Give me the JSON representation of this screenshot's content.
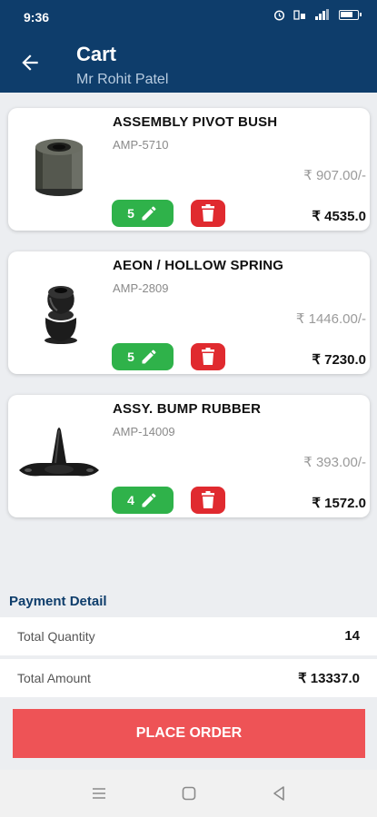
{
  "status_bar": {
    "time": "9:36",
    "icons": [
      "alarm-icon",
      "volte-icon",
      "signal-icon",
      "battery-icon"
    ]
  },
  "header": {
    "title": "Cart",
    "subtitle": "Mr Rohit Patel",
    "back_icon": "arrow-left-icon"
  },
  "cart_items": [
    {
      "name": "ASSEMBLY PIVOT BUSH",
      "code": "AMP-5710",
      "unit_price": "₹ 907.00/-",
      "quantity": "5",
      "total": "₹ 4535.0",
      "image": "pivot-bush-image"
    },
    {
      "name": "AEON / HOLLOW SPRING",
      "code": "AMP-2809",
      "unit_price": "₹ 1446.00/-",
      "quantity": "5",
      "total": "₹ 7230.0",
      "image": "hollow-spring-image"
    },
    {
      "name": "ASSY. BUMP RUBBER",
      "code": "AMP-14009",
      "unit_price": "₹ 393.00/-",
      "quantity": "4",
      "total": "₹ 1572.0",
      "image": "bump-rubber-image"
    }
  ],
  "payment": {
    "heading": "Payment Detail",
    "total_quantity_label": "Total Quantity",
    "total_quantity": "14",
    "total_amount_label": "Total Amount",
    "total_amount": "₹ 13337.0"
  },
  "place_order_label": "PLACE ORDER",
  "colors": {
    "primary": "#0e3d6b",
    "edit_green": "#2fb24a",
    "delete_red": "#e02a2f",
    "order_button": "#ee5356"
  }
}
